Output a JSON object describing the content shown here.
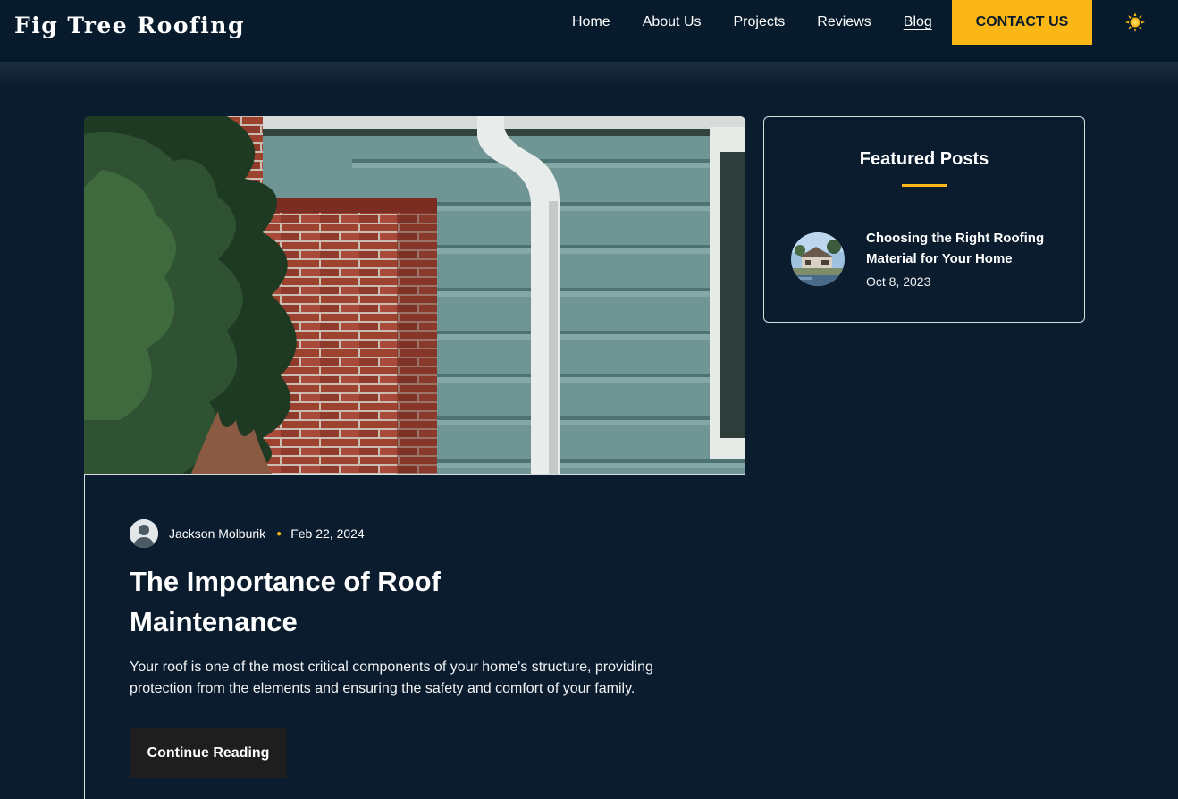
{
  "header": {
    "logo": "Fig Tree Roofing",
    "nav": [
      {
        "label": "Home"
      },
      {
        "label": "About Us"
      },
      {
        "label": "Projects"
      },
      {
        "label": "Reviews"
      },
      {
        "label": "Blog",
        "active": true
      }
    ],
    "contact_label": "CONTACT US",
    "theme_icon": "sun-icon"
  },
  "post": {
    "image_icon": "house-photo",
    "author": "Jackson Molburik",
    "date": "Feb 22, 2024",
    "title": "The Importance of Roof Maintenance",
    "excerpt": "Your roof is one of the most critical components of your home's structure, providing protection from the elements and ensuring the safety and comfort of your family.",
    "cta": "Continue Reading"
  },
  "sidebar": {
    "title": "Featured Posts",
    "posts": [
      {
        "title": "Choosing the Right Roofing Material for Your Home",
        "date": "Oct 8, 2023"
      }
    ]
  },
  "colors": {
    "background": "#0a1c2e",
    "header": "#071b2c",
    "accent": "#fbb716",
    "button_dark": "#1e1e1e"
  }
}
